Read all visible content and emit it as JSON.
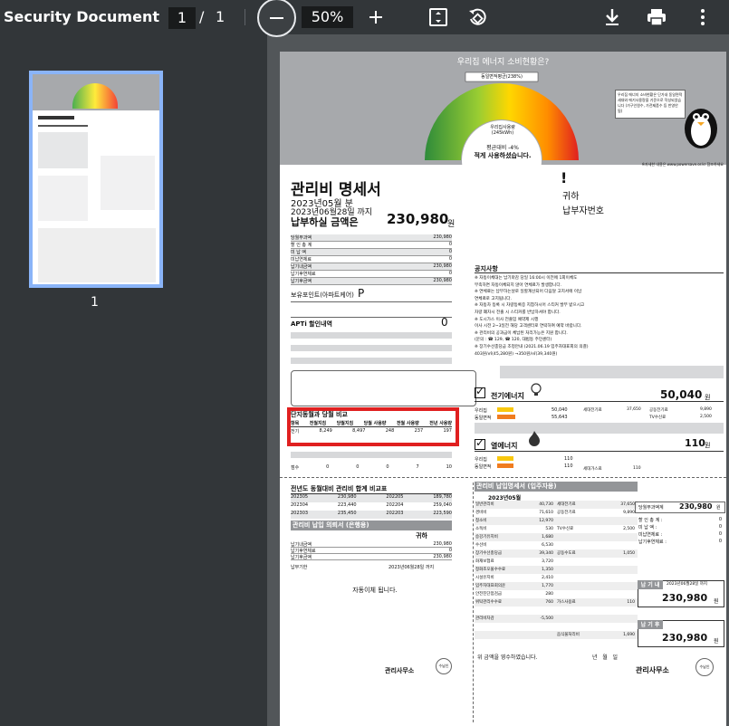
{
  "toolbar": {
    "title": "Security Document",
    "page_current": "1",
    "page_sep": "/",
    "page_total": "1",
    "zoom": "50%"
  },
  "sidebar": {
    "thumb_label": "1"
  },
  "doc": {
    "banner_title": "우리집 에너지 소비현황은?",
    "gauge_top": "동일면적평균(238%)",
    "gauge_mid": "우리집사용량\n(245kWh)",
    "gauge_compare": "평균대비 -4%",
    "gauge_msg": "적게 사용하셨습니다.",
    "gauge_marks": [
      "-40",
      "-20",
      "0",
      "20",
      "40"
    ],
    "side_note": "우리집 에너지 소비현황은 단가내 동일면적세대와 에기사용량을 기준으로 작성되었습니다 (가구인원수, 가전제품수 등 반영안됨)",
    "source_note": "※자세한 내용은 www.powersave.or.kr 참조하세요",
    "title": "관리비 명세서",
    "month": "2023년05월 분",
    "deadline": "2023년06월28일 까지",
    "pay_label": "납부하실 금액은",
    "pay_amount": "230,980",
    "pay_unit": "원",
    "addr_mark": "!",
    "addr_to": "귀하",
    "account_label": "납부자번호",
    "charges": [
      {
        "label": "당월부과액",
        "value": "230,980"
      },
      {
        "label": "할 인 총 계",
        "value": "0"
      },
      {
        "label": "미 납 액",
        "value": "0"
      },
      {
        "label": "미납연체료",
        "value": "0"
      },
      {
        "label": "납기내금액",
        "value": "230,980"
      },
      {
        "label": "납기후연체료",
        "value": "0"
      },
      {
        "label": "납기후금액",
        "value": "230,980"
      }
    ],
    "points_label": "보유포인트(아파트케어)",
    "points_value": "P",
    "apti_label": "APTi 할인내역",
    "apti_value": "0",
    "compare_title": "단지동월과 당월 비교",
    "compare_headers": [
      "항목",
      "전월지침",
      "당월지침",
      "당월 사용량",
      "전월 사용량",
      "전년 사용량"
    ],
    "compare_row": [
      "전기",
      "8,249",
      "8,497",
      "248",
      "237",
      "197"
    ],
    "water_row": [
      "점수",
      "0",
      "0",
      "0",
      "7",
      "10"
    ],
    "notice_title": "공지사항",
    "notice_lines": [
      "※ 자동이체대는 납기마감 당일 16:00시 이전에 1회이체도",
      "부족하면 자동이체되지 않아 연체료가 발생합니다.",
      "※ 연체료는 납부하는날로 일할계산되어 다음달 고지서에 이납",
      "연체료로 고지됩니다.",
      "※ 자동차 등록 시 차량등록증 지참하시어 스티커 발부 받으시고",
      "차량 폐차시 전출 시 스티커를 반납하셔야 합니다.",
      "※ 도시가스 이사 전출입 예약제 시행",
      "이사 시전 2~3일전 해당 고객센터로 연락하여 예약 바랍니다.",
      "※ 관리비의 공과금이 체납된 처리가능은 지원 합니다.",
      "(문의 : ☎ 129, ☎ 120, 대법동 주민센터)",
      "※ 장기수선충당금 조정안내 (2021.06.19 입주자대표회의 의결)",
      "403원/㎡(45,280원) →350원/㎡(39,340원)"
    ],
    "elec_label": "전기에너지",
    "elec_value": "50,040",
    "elec_unit": "원",
    "elec_rows": [
      {
        "label": "우리집",
        "val": "50,040",
        "k1": "세대전기료",
        "v1": "37,650",
        "k2": "공동전기료",
        "v2": "9,890"
      },
      {
        "label": "동일면적",
        "val": "55,643",
        "k1": "",
        "v1": "",
        "k2": "TV수신료",
        "v2": "2,500"
      }
    ],
    "heat_label": "열에너지",
    "heat_value": "110",
    "heat_unit": "원",
    "heat_rows": [
      {
        "label": "우리집",
        "val": "110",
        "k1": "",
        "v1": ""
      },
      {
        "label": "동일면적",
        "val": "110",
        "k1": "세대가스료",
        "v1": "110"
      }
    ],
    "year_title": "전년도 동월대비 관리비 합계 비교표",
    "year_rows": [
      [
        "202305",
        "230,980",
        "202205",
        "189,780"
      ],
      [
        "202304",
        "223,440",
        "202204",
        "259,040"
      ],
      [
        "202303",
        "235,450",
        "202203",
        "223,590"
      ]
    ],
    "bank_title": "관리비 납입 의뢰서 (은행용)",
    "bank_to": "귀하",
    "bank_rows": [
      {
        "label": "납기내금액",
        "value": "230,980"
      },
      {
        "label": "납기후연체료",
        "value": "0"
      },
      {
        "label": "납기후금액",
        "value": "230,980"
      }
    ],
    "bank_due_label": "납부기한",
    "bank_due": "2023년06월28일 까지",
    "auto_pay": "자동이체 됩니다.",
    "office": "관리사무소",
    "stamp": "수납인",
    "resident_title": "관리비 납입명세서 (입주자용)",
    "resident_month": "2023년05월",
    "resident_items": [
      [
        "일반관리비",
        "40,730",
        "세대전기료",
        "37,650"
      ],
      [
        "경비비",
        "71,610",
        "공동전기료",
        "9,890"
      ],
      [
        "청소비",
        "12,970",
        "",
        ""
      ],
      [
        "소독비",
        "530",
        "TV수신료",
        "2,500"
      ],
      [
        "승강기유지비",
        "1,680",
        "",
        ""
      ],
      [
        "수선비",
        "6,530",
        "",
        ""
      ],
      [
        "장기수선충당금",
        "39,340",
        "공동수도료",
        "1,050"
      ],
      [
        "화재보험료",
        "3,720",
        "",
        ""
      ],
      [
        "정화조오물수수료",
        "1,350",
        "",
        ""
      ],
      [
        "시설유지비",
        "2,410",
        "",
        ""
      ],
      [
        "입주자대표회의운",
        "1,770",
        "",
        ""
      ],
      [
        "안전진단점검금",
        "280",
        "",
        ""
      ],
      [
        "위탁관리수수료",
        "760",
        "가스사용료",
        "110"
      ],
      [
        "",
        "",
        "",
        ""
      ],
      [
        "관리비차감",
        "-5,500",
        "",
        ""
      ],
      [
        "",
        "",
        "",
        ""
      ],
      [
        "",
        "",
        "음식물처리비",
        "1,690"
      ]
    ],
    "month_total_label": "당월부과액계",
    "month_total": "230,980",
    "month_total_unit": "원",
    "right_rows": [
      {
        "label": "할 인 총 계 :",
        "value": "0"
      },
      {
        "label": "미 납 액 :",
        "value": "0"
      },
      {
        "label": "미납연체료 :",
        "value": "0"
      },
      {
        "label": "납기후연체료 :",
        "value": "0"
      }
    ],
    "due_in_label": "납 기 내",
    "due_in_date": "2023년06월28일 까지",
    "due_in_amount": "230,980",
    "due_after_label": "납 기 후",
    "due_after_amount": "230,980",
    "won": "원",
    "receipt_text": "위 금액을 영수하였습니다.",
    "receipt_date": "년   월   일"
  },
  "colors": {
    "highlight": "#e02020",
    "toolbar": "#323639",
    "viewer_bg": "#525659",
    "thumb_border": "#8ab4f8"
  }
}
